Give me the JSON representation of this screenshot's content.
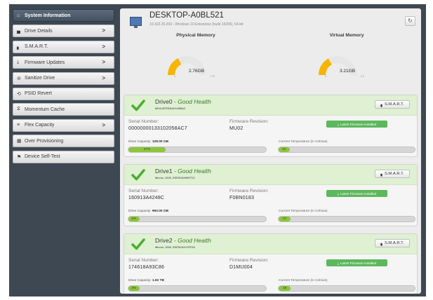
{
  "sidebar": {
    "items": [
      {
        "label": "System Information",
        "icon": "home-icon",
        "glyph": "⌂",
        "has_arrow": false,
        "active": true
      },
      {
        "label": "Drive Details",
        "icon": "drive-icon",
        "glyph": "▄",
        "has_arrow": true,
        "active": false
      },
      {
        "label": "S.M.A.R.T.",
        "icon": "bar-chart-icon",
        "glyph": "▖",
        "has_arrow": true,
        "active": false
      },
      {
        "label": "Firmware Updates",
        "icon": "download-icon",
        "glyph": "⤓",
        "has_arrow": true,
        "active": false
      },
      {
        "label": "Sanitize Drive",
        "icon": "ban-icon",
        "glyph": "⊘",
        "has_arrow": true,
        "active": false
      },
      {
        "label": "PSID Revert",
        "icon": "revert-icon",
        "glyph": "⟲",
        "has_arrow": false,
        "active": false
      },
      {
        "label": "Momentum Cache",
        "icon": "funnel-icon",
        "glyph": "⧖",
        "has_arrow": false,
        "active": false
      },
      {
        "label": "Flex Capacity",
        "icon": "sliders-icon",
        "glyph": "≡",
        "has_arrow": true,
        "active": false
      },
      {
        "label": "Over Provisioning",
        "icon": "grid-icon",
        "glyph": "▦",
        "has_arrow": false,
        "active": false
      },
      {
        "label": "Device Self-Test",
        "icon": "flag-icon",
        "glyph": "⚑",
        "has_arrow": false,
        "active": false
      }
    ],
    "arrow": ">"
  },
  "header": {
    "hostname": "DESKTOP-A0BL521",
    "subtitle": "10.102.29.200 - Windows 10 Enterprise (build 15296), 64-bit",
    "refresh_icon": "refresh-icon",
    "refresh_glyph": "↻"
  },
  "memory": {
    "physical": {
      "title": "Physical Memory",
      "value": "2.76GB",
      "min": "0",
      "max": "7.93",
      "fraction": 0.35
    },
    "virtual": {
      "title": "Virtual Memory",
      "value": "3.21GB",
      "min": "0",
      "max": "9.5",
      "fraction": 0.34
    }
  },
  "colors": {
    "sidebar_bg": "#3e4852",
    "gauge_fill": "#f7b500",
    "gauge_track": "#e6e6e6",
    "health_green": "#4cae32",
    "badge_green": "#5cb85c",
    "bar_fill": "#8cc63f"
  },
  "labels": {
    "serial": "Serial Number:",
    "firmware": "Firmware Revision:",
    "capacity": "Drive Capacity:",
    "temperature": "Current Temperature (in Celsius)",
    "smart_button": "S.M.A.R.T.",
    "fw_badge": "Latest Firmware Installed"
  },
  "drives": [
    {
      "name": "Drive0",
      "health": " - Good Health",
      "model": "MI1S-MTFDDAV128MAZ",
      "serial": "00000000133102058AC7",
      "firmware": "MU02",
      "capacity": "128.00 GB",
      "used_pct": "27%",
      "used_fraction": 0.27,
      "temp": "31",
      "temp_fraction": 0.08
    },
    {
      "name": "Drive1",
      "health": " - Good Health",
      "model": "Micron_5100_ESFDDAV960TCC",
      "serial": "160913A4248C",
      "firmware": "F0BN0183",
      "capacity": "960.00 GB",
      "used_pct": "2%",
      "used_fraction": 0.08,
      "temp": "27",
      "temp_fraction": 0.09
    },
    {
      "name": "Drive2",
      "health": " - Good Health",
      "model": "Micron_5200_ESFDDAV1T9TDC",
      "serial": "174618A93C86",
      "firmware": "D1MU004",
      "capacity": "1.92 TB",
      "used_pct": "3%",
      "used_fraction": 0.08,
      "temp": "28",
      "temp_fraction": 0.09
    }
  ]
}
